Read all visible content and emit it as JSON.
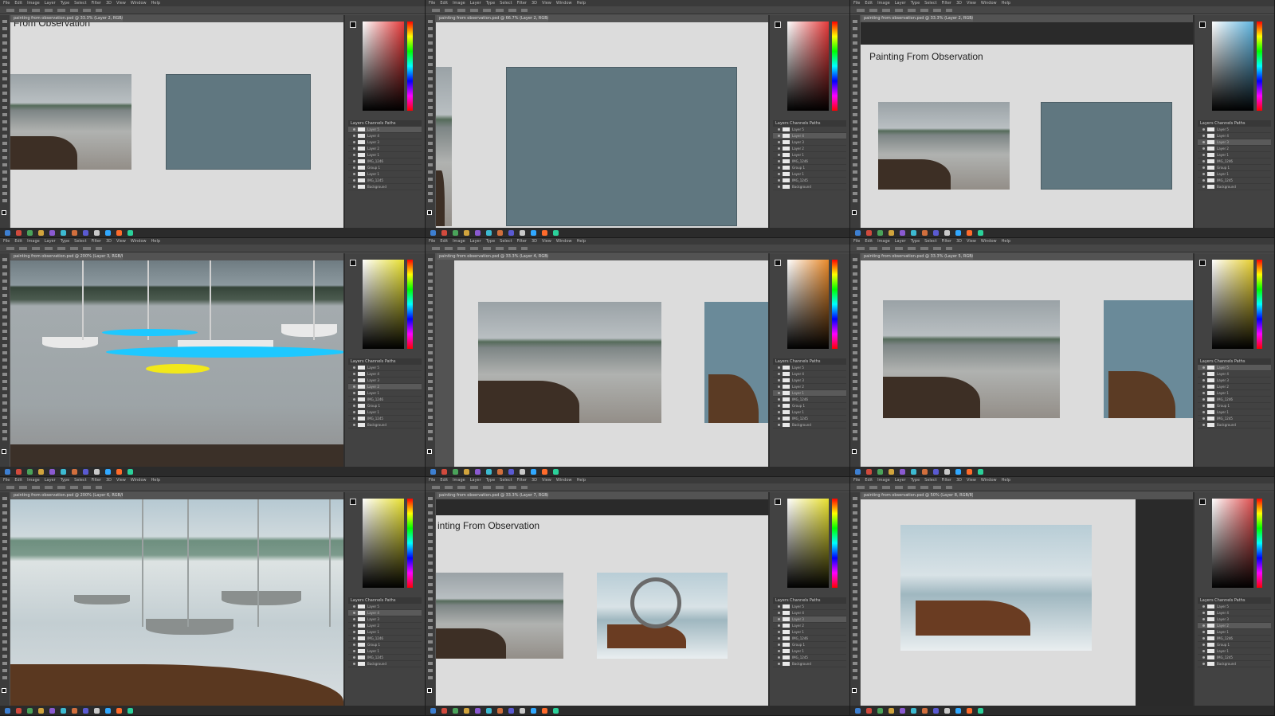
{
  "menu": [
    "File",
    "Edit",
    "Image",
    "Layer",
    "Type",
    "Select",
    "Filter",
    "3D",
    "View",
    "Window",
    "Help"
  ],
  "tiles": [
    {
      "id": "t1",
      "doc_tab": "painting from observation.psd @ 33.3% (Layer 2, RGB/8)",
      "title": "From Observation",
      "picker_top": "#e63a3a"
    },
    {
      "id": "t2",
      "doc_tab": "painting from observation.psd @ 66.7% (Layer 2, RGB/8)",
      "title": "",
      "picker_top": "#e63a3a"
    },
    {
      "id": "t3",
      "doc_tab": "painting from observation.psd @ 33.3% (Layer 2, RGB/8)",
      "title": "Painting From Observation",
      "picker_top": "#5fb5e0"
    },
    {
      "id": "t4",
      "doc_tab": "painting from observation.psd @ 200% (Layer 3, RGB/8)",
      "title": "",
      "picker_top": "#e8e030"
    },
    {
      "id": "t5",
      "doc_tab": "painting from observation.psd @ 33.3% (Layer 4, RGB/8)",
      "title": "",
      "picker_top": "#e8892a"
    },
    {
      "id": "t6",
      "doc_tab": "painting from observation.psd @ 33.3% (Layer 5, RGB/8)",
      "title": "",
      "picker_top": "#e8d030"
    },
    {
      "id": "t7",
      "doc_tab": "painting from observation.psd @ 200% (Layer 6, RGB/8)",
      "title": "",
      "picker_top": "#e8e030"
    },
    {
      "id": "t8",
      "doc_tab": "painting from observation.psd @ 33.3% (Layer 7, RGB/8)",
      "title": "inting From Observation",
      "picker_top": "#e8e030"
    },
    {
      "id": "t9",
      "doc_tab": "painting from observation.psd @ 50% (Layer 8, RGB/8)",
      "title": "",
      "picker_top": "#e05050"
    }
  ],
  "layers_panel": {
    "tabs": "Layers  Channels  Paths",
    "rows": [
      "Layer 5",
      "Layer 4",
      "Layer 3",
      "Layer 2",
      "Layer 1",
      "IMG_1246",
      "Group 1",
      "Layer 1",
      "IMG_1245",
      "Background"
    ]
  },
  "colors": {
    "accent_cyan": "#1ec8ff",
    "accent_yellow": "#f2e81a"
  }
}
